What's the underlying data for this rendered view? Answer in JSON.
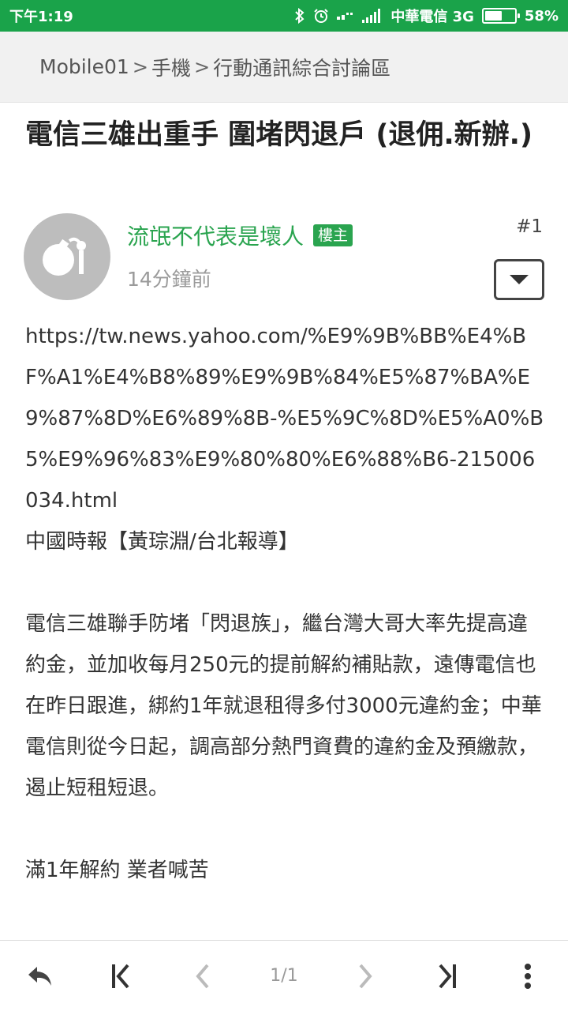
{
  "statusbar": {
    "time": "下午1:19",
    "carrier": "中華電信 3G",
    "battery_pct": "58%",
    "battery_level": 0.58,
    "icons": [
      "bluetooth-icon",
      "alarm-icon",
      "signal-dots-icon",
      "signal-bars-icon",
      "battery-icon"
    ]
  },
  "breadcrumb": {
    "items": [
      "Mobile01",
      "手機",
      "行動通訊綜合討論區"
    ],
    "separator": ">"
  },
  "thread": {
    "title": "電信三雄出重手 圍堵閃退戶 (退佣.新辦.)"
  },
  "post": {
    "author": "流氓不代表是壞人",
    "op_badge": "樓主",
    "time": "14分鐘前",
    "floor": "#1",
    "url": "https://tw.news.yahoo.com/%E9%9B%BB%E4%BF%A1%E4%B8%89%E9%9B%84%E5%87%BA%E9%87%8D%E6%89%8B-%E5%9C%8D%E5%A0%B5%E9%96%83%E9%80%80%E6%88%B6-215006034.html",
    "source": "中國時報【黃琮淵/台北報導】",
    "paragraph1": "電信三雄聯手防堵「閃退族」，繼台灣大哥大率先提高違約金，並加收每月250元的提前解約補貼款，遠傳電信也在昨日跟進，綁約1年就退租得多付3000元違約金；中華電信則從今日起，調高部分熱門資費的違約金及預繳款，遏止短租短退。",
    "subheading": "滿1年解約 業者喊苦"
  },
  "bottom_bar": {
    "page_indicator": "1/1",
    "accent_color": "#2aa44f"
  }
}
